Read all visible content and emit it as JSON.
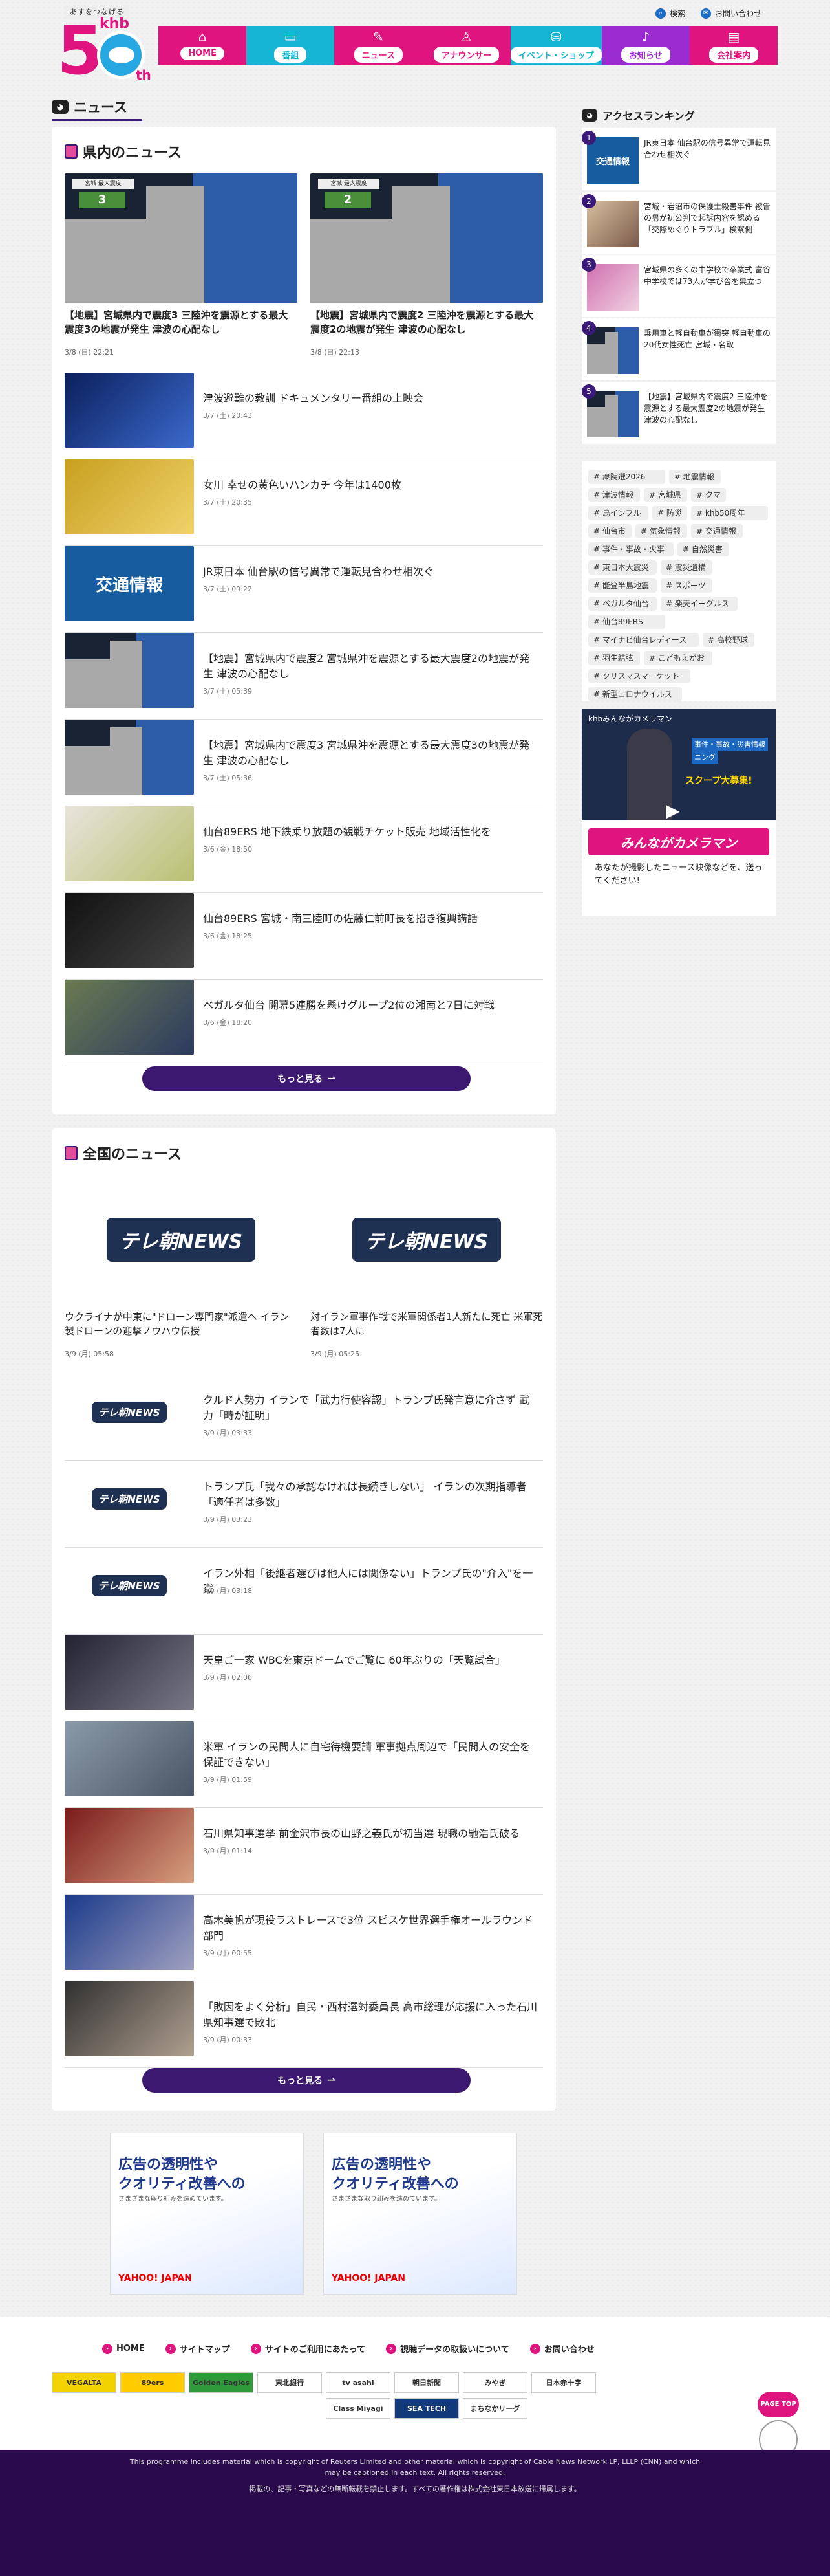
{
  "logo": {
    "tagline": "あすをつなげる",
    "brand": "khb",
    "number": "5",
    "suffix": "th"
  },
  "toplinks": [
    {
      "label": "検索",
      "icon": "search-icon"
    },
    {
      "label": "お問い合わせ",
      "icon": "mail-icon"
    }
  ],
  "nav": [
    {
      "label": "HOME",
      "icon": "home-icon",
      "color": "#e0147e"
    },
    {
      "label": "番組",
      "icon": "tv-icon",
      "color": "#15b5d3"
    },
    {
      "label": "ニュース",
      "icon": "news-icon",
      "color": "#e0147e"
    },
    {
      "label": "アナウンサー",
      "icon": "announcer-icon",
      "color": "#e0147e"
    },
    {
      "label": "イベント・ショップ",
      "icon": "event-icon",
      "color": "#15b5d3"
    },
    {
      "label": "お知らせ",
      "icon": "bell-icon",
      "color": "#9a2bd0"
    },
    {
      "label": "会社案内",
      "icon": "building-icon",
      "color": "#e0147e"
    }
  ],
  "page_title": "ニュース",
  "local": {
    "title": "県内のニュース",
    "big": [
      {
        "title": "【地震】宮城県内で震度3 三陸沖を震源とする最大震度3の地震が発生 津波の心配なし",
        "date": "3/8 (日) 22:21",
        "badge": "3",
        "badge_label": "宮城 最大震度"
      },
      {
        "title": "【地震】宮城県内で震度2 三陸沖を震源とする最大震度2の地震が発生 津波の心配なし",
        "date": "3/8 (日) 22:13",
        "badge": "2",
        "badge_label": "宮城 最大震度"
      }
    ],
    "list": [
      {
        "title": "津波避難の教訓 ドキュメンタリー番組の上映会",
        "date": "3/7 (土) 20:43",
        "thumb": "video"
      },
      {
        "title": "女川 幸せの黄色いハンカチ 今年は1400枚",
        "date": "3/7 (土) 20:35",
        "thumb": "yellow"
      },
      {
        "title": "JR東日本 仙台駅の信号異常で運転見合わせ相次ぐ",
        "date": "3/7 (土) 09:22",
        "thumb": "traffic",
        "thumb_text": "交通情報"
      },
      {
        "title": "【地震】宮城県内で震度2 宮城県沖を震源とする最大震度2の地震が発生 津波の心配なし",
        "date": "3/7 (土) 05:39",
        "thumb": "map"
      },
      {
        "title": "【地震】宮城県内で震度3 宮城県沖を震源とする最大震度3の地震が発生 津波の心配なし",
        "date": "3/7 (土) 05:36",
        "thumb": "map"
      },
      {
        "title": "仙台89ERS 地下鉄乗り放題の観戦チケット販売 地域活性化を",
        "date": "3/6 (金) 18:50",
        "thumb": "phone"
      },
      {
        "title": "仙台89ERS 宮城・南三陸町の佐藤仁前町長を招き復興講話",
        "date": "3/6 (金) 18:25",
        "thumb": "dark"
      },
      {
        "title": "ベガルタ仙台 開幕5連勝を懸けグループ2位の湘南と7日に対戦",
        "date": "3/6 (金) 18:20",
        "thumb": "sport"
      }
    ],
    "more": "もっと見る"
  },
  "national": {
    "title": "全国のニュース",
    "logo_text": "テレ朝NEWS",
    "big": [
      {
        "title": "ウクライナが中東に\"ドローン専門家\"派遣へ イラン製ドローンの迎撃ノウハウ伝授",
        "date": "3/9 (月) 05:58"
      },
      {
        "title": "対イラン軍事作戦で米軍関係者1人新たに死亡 米軍死者数は7人に",
        "date": "3/9 (月) 05:25"
      }
    ],
    "list": [
      {
        "title": "クルド人勢力 イランで「武力行使容認」トランプ氏発言意に介さず 武力「時が証明」",
        "date": "3/9 (月) 03:33",
        "thumb": "logo"
      },
      {
        "title": "トランプ氏「我々の承認なければ長続きしない」 イランの次期指導者「適任者は多数」",
        "date": "3/9 (月) 03:23",
        "thumb": "logo"
      },
      {
        "title": "イラン外相「後継者選びは他人には関係ない」トランプ氏の\"介入\"を一蹴",
        "date": "3/9 (月) 03:18",
        "thumb": "logo"
      },
      {
        "title": "天皇ご一家 WBCを東京ドームでご覧に 60年ぶりの「天覧試合」",
        "date": "3/9 (月) 02:06",
        "thumb": "photo"
      },
      {
        "title": "米軍 イランの民間人に自宅待機要請 軍事拠点周辺で「民間人の安全を保証できない」",
        "date": "3/9 (月) 01:59",
        "thumb": "photo"
      },
      {
        "title": "石川県知事選挙 前金沢市長の山野之義氏が初当選 現職の馳浩氏破る",
        "date": "3/9 (月) 01:14",
        "thumb": "photo"
      },
      {
        "title": "高木美帆が現役ラストレースで3位 スピスケ世界選手権オールラウンド部門",
        "date": "3/9 (月) 00:55",
        "thumb": "photo"
      },
      {
        "title": "「敗因をよく分析」自民・西村選対委員長 高市総理が応援に入った石川県知事選で敗北",
        "date": "3/9 (月) 00:33",
        "thumb": "photo"
      }
    ],
    "more": "もっと見る"
  },
  "ads": [
    {
      "line1": "広告の透明性や",
      "line2": "クオリティ改善への",
      "line3": "さまざまな取り組みを進めています。",
      "brand": "YAHOO! JAPAN"
    },
    {
      "line1": "広告の透明性や",
      "line2": "クオリティ改善への",
      "line3": "さまざまな取り組みを進めています。",
      "brand": "YAHOO! JAPAN"
    }
  ],
  "ranking": {
    "title": "アクセスランキング",
    "items": [
      {
        "n": "1",
        "title": "JR東日本 仙台駅の信号異常で運転見合わせ相次ぐ",
        "thumb_text": "交通情報"
      },
      {
        "n": "2",
        "title": "宮城・岩沼市の保護士殺害事件 被告の男が初公判で起訴内容を認める 「交際めぐりトラブル」検察側",
        "thumb_text": ""
      },
      {
        "n": "3",
        "title": "宮城県の多くの中学校で卒業式 富谷中学校では73人が学び舎を巣立つ",
        "thumb_text": ""
      },
      {
        "n": "4",
        "title": "乗用車と軽自動車が衝突 軽自動車の20代女性死亡 宮城・名取",
        "thumb_text": ""
      },
      {
        "n": "5",
        "title": "【地震】宮城県内で震度2 三陸沖を震源とする最大震度2の地震が発生 津波の心配なし",
        "thumb_text": ""
      }
    ]
  },
  "tags": [
    "衆院選2026",
    "地震情報",
    "津波情報",
    "宮城県",
    "クマ",
    "鳥インフル",
    "防災",
    "khb50周年",
    "仙台市",
    "気象情報",
    "交通情報",
    "事件・事故・火事",
    "自然災害",
    "東日本大震災",
    "震災遺構",
    "能登半島地震",
    "スポーツ",
    "ベガルタ仙台",
    "楽天イーグルス",
    "仙台89ERS",
    "マイナビ仙台レディース",
    "高校野球",
    "羽生結弦",
    "こどもえがお",
    "クリスマスマーケット",
    "新型コロナウイルス"
  ],
  "camera": {
    "banner": "khbみんながカメラマン",
    "caption": "あなたが撮影したニュース映像などを、送ってください!",
    "overlay1": "事件・事故・災害情報",
    "overlay2": "ニング",
    "overlay3": "スクープ大募集!",
    "logo": "みんながカメラマン"
  },
  "footer": {
    "links": [
      "HOME",
      "サイトマップ",
      "サイトのご利用にあたって",
      "視聴データの取扱いについて",
      "お問い合わせ"
    ],
    "partners": [
      "VEGALTA",
      "89ers",
      "Golden Eagles",
      "東北銀行",
      "tv asahi",
      "朝日新聞",
      "みやぎ",
      "日本赤十字",
      "Class Miyagi",
      "SEA TECH",
      "まちなかリーグ"
    ],
    "pagetop": "PAGE TOP",
    "copyright1": "This programme includes material which is copyright of Reuters Limited and other material which is copyright of Cable News Network LP, LLLP (CNN) and which",
    "copyright2": "may be captioned in each text. All rights reserved.",
    "copyright3": "掲載の、記事・写真などの無断転載を禁止します。すべての著作権は株式会社東日本放送に帰属します。"
  },
  "colors": {
    "accent": "#3c1870",
    "pink": "#e0147e",
    "cyan": "#15b5d3"
  }
}
